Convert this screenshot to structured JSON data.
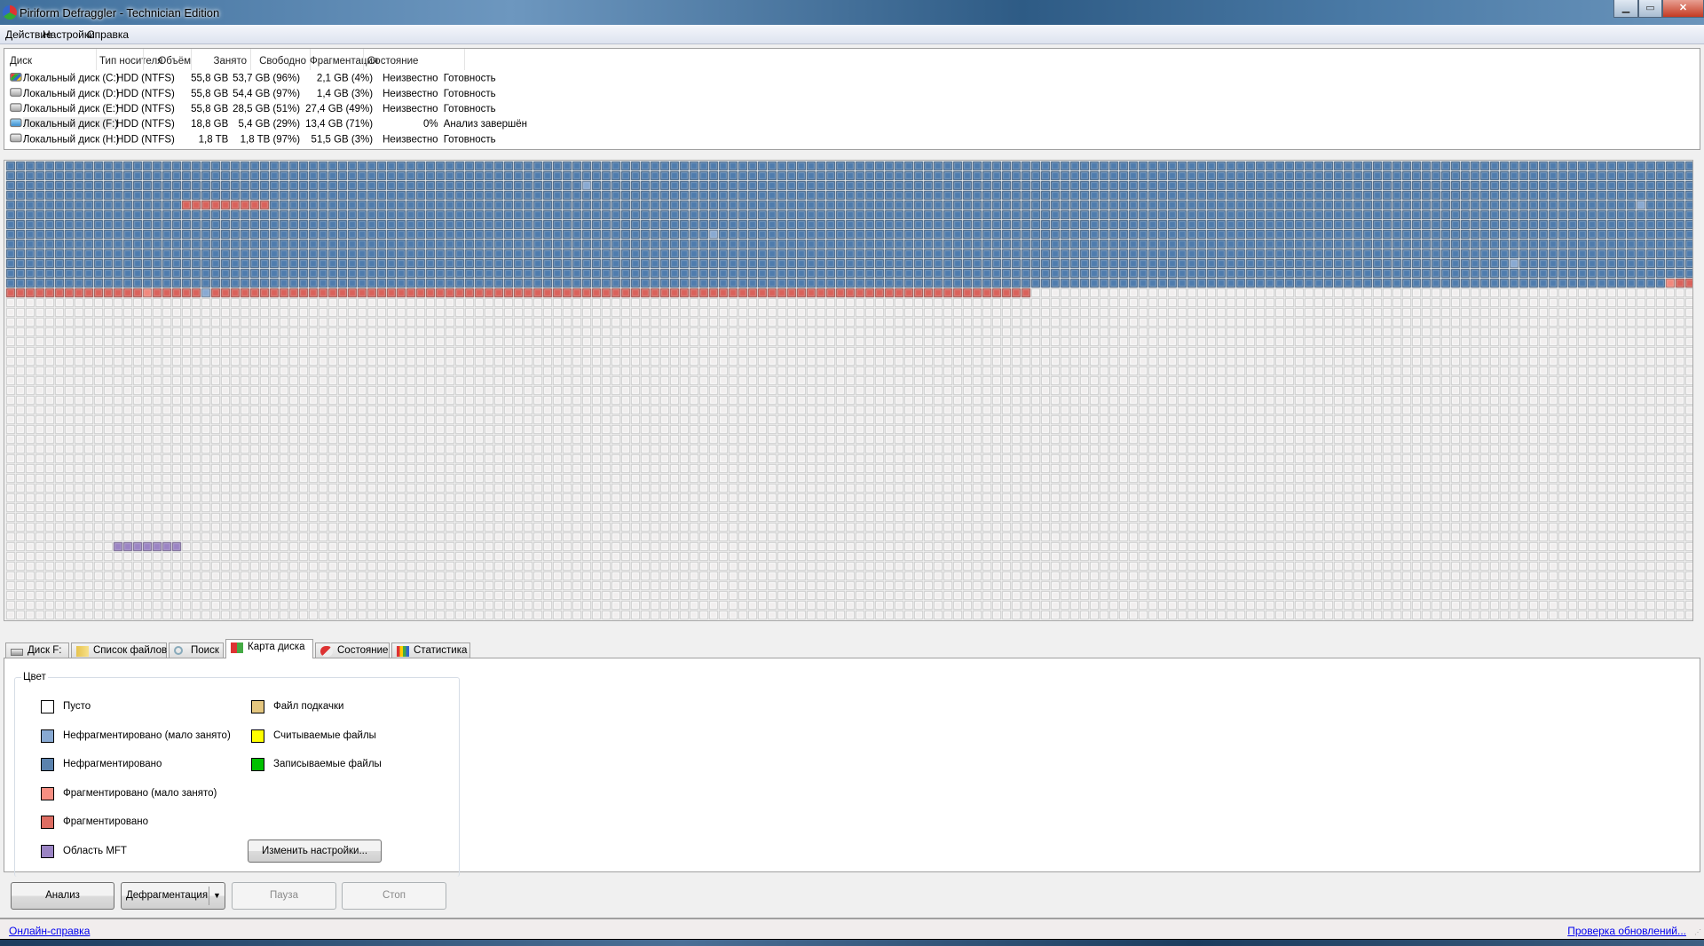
{
  "window": {
    "title": "Piriform Defraggler - Technician Edition",
    "controls": [
      "minimize",
      "maximize",
      "close"
    ]
  },
  "menu": [
    "Действие",
    "Настройки",
    "Справка"
  ],
  "drives": {
    "columns": [
      "Диск",
      "Тип носителя",
      "Объём",
      "Занято",
      "Свободно",
      "Фрагментация",
      "Состояние"
    ],
    "rows": [
      {
        "name": "Локальный диск (C:)",
        "type": "HDD (NTFS)",
        "size": "55,8 GB",
        "used": "53,7 GB (96%)",
        "free": "2,1 GB (4%)",
        "frag": "Неизвестно",
        "status": "Готовность",
        "icon": "system-drive-icon"
      },
      {
        "name": "Локальный диск (D:)",
        "type": "HDD (NTFS)",
        "size": "55,8 GB",
        "used": "54,4 GB (97%)",
        "free": "1,4 GB (3%)",
        "frag": "Неизвестно",
        "status": "Готовность",
        "icon": "drive-icon"
      },
      {
        "name": "Локальный диск (E:)",
        "type": "HDD (NTFS)",
        "size": "55,8 GB",
        "used": "28,5 GB (51%)",
        "free": "27,4 GB (49%)",
        "frag": "Неизвестно",
        "status": "Готовность",
        "icon": "drive-icon"
      },
      {
        "name": "Локальный диск (F:)",
        "type": "HDD (NTFS)",
        "size": "18,8 GB",
        "used": "5,4 GB (29%)",
        "free": "13,4 GB (71%)",
        "frag": "0%",
        "status": "Анализ завершён",
        "icon": "drive-icon",
        "selected": true
      },
      {
        "name": "Локальный диск (H:)",
        "type": "HDD (NTFS)",
        "size": "1,8 TB",
        "used": "1,8 TB (97%)",
        "free": "51,5 GB (3%)",
        "frag": "Неизвестно",
        "status": "Готовность",
        "icon": "drive-icon"
      }
    ]
  },
  "disk_map": {
    "columns": 173,
    "rows": 47,
    "default": "empty",
    "runs": [
      {
        "type": "unfrag",
        "start": 0,
        "count": 2249
      },
      {
        "type": "frag",
        "start": 710,
        "count": 9
      },
      {
        "type": "frag",
        "start": 2249,
        "count": 105
      },
      {
        "type": "frag_low",
        "start": 2263,
        "count": 1
      },
      {
        "type": "unfrag_low",
        "start": 2269,
        "count": 1
      },
      {
        "type": "frag_low",
        "start": 2246,
        "count": 1
      },
      {
        "type": "frag",
        "start": 2247,
        "count": 2
      },
      {
        "type": "unfrag_low",
        "start": 405,
        "count": 1
      },
      {
        "type": "unfrag_low",
        "start": 1283,
        "count": 1
      },
      {
        "type": "unfrag_low",
        "start": 859,
        "count": 1
      },
      {
        "type": "unfrag_low",
        "start": 1884,
        "count": 1
      },
      {
        "type": "mft",
        "start": 6758,
        "count": 7
      }
    ]
  },
  "colors": {
    "empty": "#f8f8f8",
    "unfrag_low": "#88a9d2",
    "unfrag": "#4f7cad",
    "frag_low": "#f2887d",
    "frag": "#d9625b",
    "mft": "#9b84c4",
    "pagefile": "#e4c67f",
    "reading": "#ffff00",
    "writing": "#00c000"
  },
  "tabs": [
    {
      "label": "Диск F:",
      "icon": "drive-icon"
    },
    {
      "label": "Список файлов",
      "icon": "folder-icon"
    },
    {
      "label": "Поиск",
      "icon": "search-icon"
    },
    {
      "label": "Карта диска",
      "icon": "blocks-icon",
      "active": true
    },
    {
      "label": "Состояние",
      "icon": "pill-icon"
    },
    {
      "label": "Статистика",
      "icon": "bar-chart-icon"
    }
  ],
  "legend": {
    "title": "Цвет",
    "left": [
      {
        "label": "Пусто",
        "color": "#ffffff"
      },
      {
        "label": "Нефрагментировано (мало занято)",
        "color": "#88a9d2"
      },
      {
        "label": "Нефрагментировано",
        "color": "#5b82ad"
      },
      {
        "label": "Фрагментировано (мало занято)",
        "color": "#f78f82"
      },
      {
        "label": "Фрагментировано",
        "color": "#dd6d62"
      },
      {
        "label": "Область MFT",
        "color": "#9b84c4"
      }
    ],
    "right": [
      {
        "label": "Файл подкачки",
        "color": "#e4c67f"
      },
      {
        "label": "Считываемые файлы",
        "color": "#ffff00"
      },
      {
        "label": "Записываемые файлы",
        "color": "#00c000"
      }
    ],
    "settings_button": "Изменить настройки..."
  },
  "buttons": {
    "analyze": "Анализ",
    "defrag": "Дефрагментация",
    "pause": "Пауза",
    "stop": "Стоп"
  },
  "status": {
    "help_link": "Онлайн-справка",
    "update_link": "Проверка обновлений..."
  }
}
